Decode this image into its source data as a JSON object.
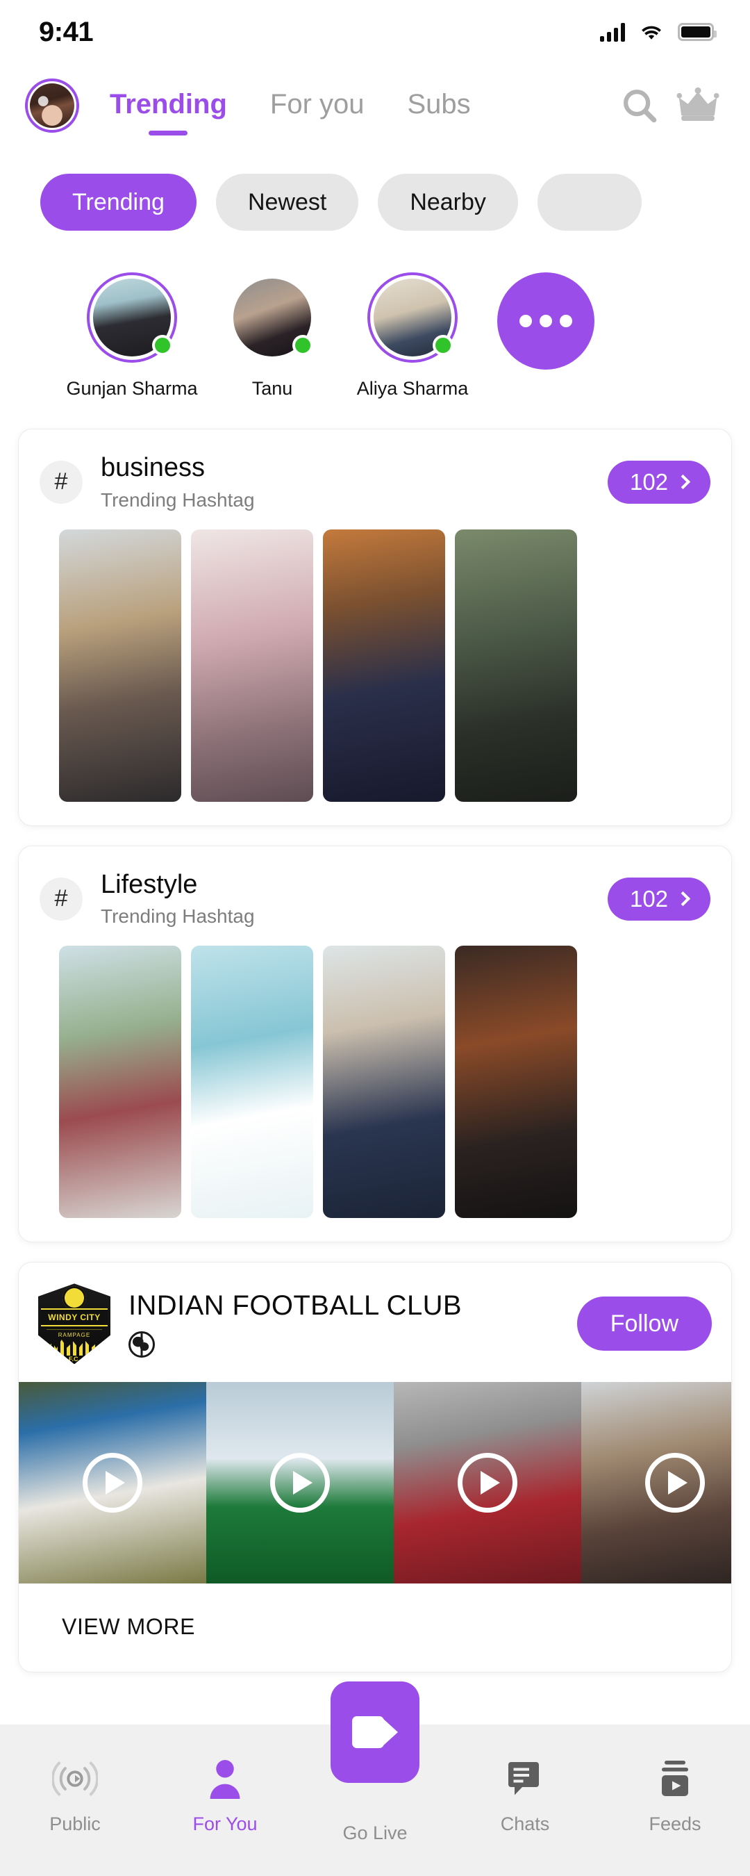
{
  "status_bar": {
    "time": "9:41",
    "icons": [
      "signal-bars-icon",
      "wifi-icon",
      "battery-icon"
    ]
  },
  "header": {
    "avatar": "user-avatar",
    "tabs": [
      {
        "label": "Trending",
        "active": true
      },
      {
        "label": "For you",
        "active": false
      },
      {
        "label": "Subs",
        "active": false
      }
    ],
    "search_icon": "search-icon",
    "crown_icon": "crown-icon"
  },
  "filter_chips": [
    {
      "label": "Trending",
      "active": true
    },
    {
      "label": "Newest",
      "active": false
    },
    {
      "label": "Nearby",
      "active": false
    },
    {
      "label": "",
      "active": false
    }
  ],
  "stories": {
    "items": [
      {
        "name": "Gunjan Sharma",
        "ring": true,
        "online": true
      },
      {
        "name": "Tanu",
        "ring": false,
        "online": true
      },
      {
        "name": "Aliya Sharma",
        "ring": true,
        "online": true
      }
    ],
    "more_button": "more-stories-button"
  },
  "hashtag_cards": [
    {
      "hash_symbol": "#",
      "title": "business",
      "subtitle": "Trending Hashtag",
      "count": "102",
      "thumbnails": 4
    },
    {
      "hash_symbol": "#",
      "title": "Lifestyle",
      "subtitle": "Trending Hashtag",
      "count": "102",
      "thumbnails": 4
    }
  ],
  "club_card": {
    "logo": {
      "band_text": "WINDY CITY",
      "band2_text": "RAMPAGE",
      "fc_text": "F.C."
    },
    "name": "INDIAN FOOTBALL CLUB",
    "globe_icon": "globe-icon",
    "follow_label": "Follow",
    "videos": 4,
    "view_more_label": "VIEW MORE"
  },
  "bottom_nav": {
    "items": [
      {
        "label": "Public",
        "icon": "broadcast-icon",
        "active": false
      },
      {
        "label": "For You",
        "icon": "person-icon",
        "active": true
      },
      {
        "label": "Go Live",
        "icon": "video-camera-icon",
        "active": false
      },
      {
        "label": "Chats",
        "icon": "chat-icon",
        "active": false
      },
      {
        "label": "Feeds",
        "icon": "feed-icon",
        "active": false
      }
    ]
  },
  "colors": {
    "accent": "#9B4DEA",
    "chip_inactive": "#e6e6e6",
    "online": "#31c42a",
    "muted_text": "#8e8e8e",
    "nav_background": "#f0f0f0"
  }
}
